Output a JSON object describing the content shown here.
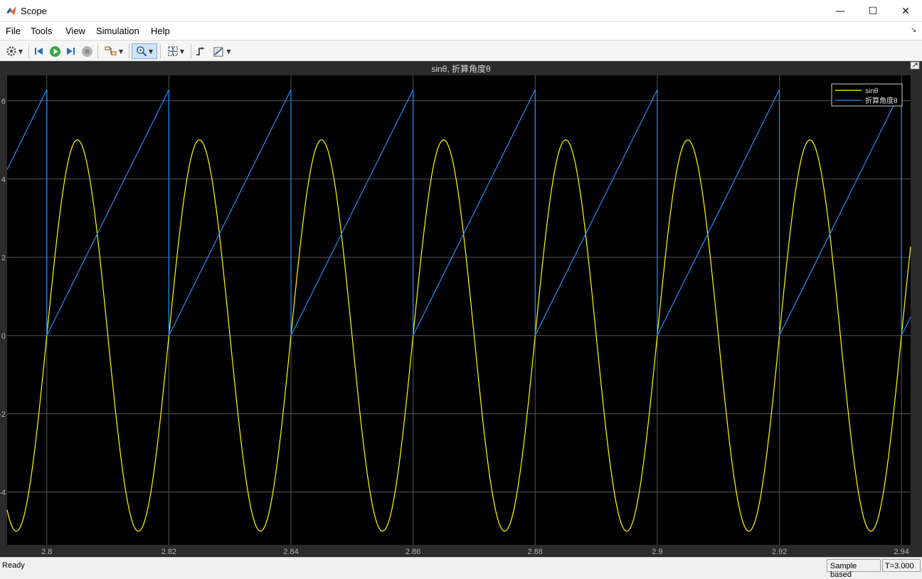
{
  "window": {
    "title": "Scope"
  },
  "window_controls": {
    "minimize": "—",
    "maximize": "☐",
    "close": "✕"
  },
  "menu": {
    "items": [
      "File",
      "Tools",
      "View",
      "Simulation",
      "Help"
    ]
  },
  "toolbar": {
    "icons": [
      "settings-icon",
      "step-back-icon",
      "run-icon",
      "step-forward-icon",
      "stop-icon",
      "highlight-block-icon",
      "zoom-icon",
      "autoscale-icon",
      "triggers-icon",
      "measurements-icon"
    ]
  },
  "status": {
    "text": "Ready",
    "mode": "Sample based",
    "time": "T=3.000"
  },
  "colors": {
    "background": "#000000",
    "axes_area": "#2b2b2b",
    "grid": "#555555",
    "ticks": "#b0b0b0",
    "yellow_series": "#ffff00",
    "blue_series": "#1e90ff"
  },
  "chart_data": {
    "type": "line",
    "title": "sinθ, 折算角度θ",
    "xlabel": "",
    "ylabel": "",
    "xlim": [
      2.7935,
      2.9415
    ],
    "ylim": [
      -5.35,
      6.65
    ],
    "xticks": [
      2.8,
      2.82,
      2.84,
      2.86,
      2.88,
      2.9,
      2.92,
      2.94
    ],
    "xtick_labels": [
      "2.8",
      "2.82",
      "2.84",
      "2.86",
      "2.88",
      "2.9",
      "2.92",
      "2.94"
    ],
    "yticks": [
      -4,
      -2,
      0,
      2,
      4,
      6
    ],
    "ytick_labels": [
      "-4",
      "-2",
      "0",
      "2",
      "4",
      "6"
    ],
    "grid": true,
    "legend_position": "top-right",
    "series": [
      {
        "name": "sinθ",
        "color": "#ffff00",
        "kind": "sine",
        "amplitude": 5,
        "period": 0.02,
        "phase_zero": 2.8
      },
      {
        "name": "折算角度θ",
        "color": "#1e90ff",
        "kind": "sawtooth",
        "min": 0,
        "max": 6.2832,
        "period": 0.02,
        "phase_zero": 2.8
      }
    ]
  }
}
